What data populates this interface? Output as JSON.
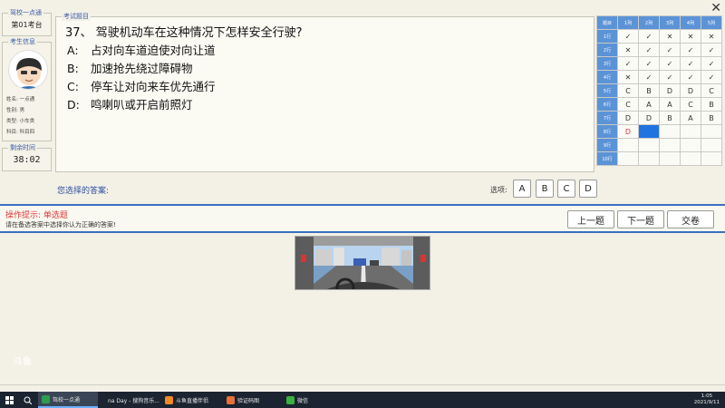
{
  "window": {
    "close_label": "✕"
  },
  "school": {
    "title": "驾校一点通",
    "seat": "第01考台"
  },
  "candidate": {
    "title": "考生信息",
    "rows": [
      {
        "label": "姓名:",
        "value": "一点通"
      },
      {
        "label": "性别:",
        "value": "男"
      },
      {
        "label": "类型:",
        "value": "小车类"
      },
      {
        "label": "科目:",
        "value": "科目四"
      }
    ]
  },
  "timer": {
    "title": "剩余时间",
    "value": "38:02"
  },
  "question": {
    "panel_title": "考试题目",
    "text": "37、 驾驶机动车在这种情况下怎样安全行驶?",
    "options": [
      {
        "letter": "A:",
        "text": "占对向车道迫使对向让道"
      },
      {
        "letter": "B:",
        "text": "加速抢先绕过障碍物"
      },
      {
        "letter": "C:",
        "text": "停车让对向来车优先通行"
      },
      {
        "letter": "D:",
        "text": "鸣喇叭或开启前照灯"
      }
    ]
  },
  "answer": {
    "your_answer_label": "您选择的答案:",
    "options_label": "选项:",
    "buttons": [
      "A",
      "B",
      "C",
      "D"
    ]
  },
  "grid": {
    "corner": "题目",
    "columns": [
      "1列",
      "2列",
      "3列",
      "4列",
      "5列"
    ],
    "rows": [
      {
        "label": "1行",
        "cells": [
          "✓",
          "✓",
          "✕",
          "✕",
          "✕"
        ]
      },
      {
        "label": "2行",
        "cells": [
          "✕",
          "✓",
          "✓",
          "✓",
          "✓"
        ]
      },
      {
        "label": "3行",
        "cells": [
          "✓",
          "✓",
          "✓",
          "✓",
          "✓"
        ]
      },
      {
        "label": "4行",
        "cells": [
          "✕",
          "✓",
          "✓",
          "✓",
          "✓"
        ]
      },
      {
        "label": "5行",
        "cells": [
          "C",
          "B",
          "D",
          "D",
          "C"
        ]
      },
      {
        "label": "6行",
        "cells": [
          "C",
          "A",
          "A",
          "C",
          "B"
        ]
      },
      {
        "label": "7行",
        "cells": [
          "D",
          "D",
          "B",
          "A",
          "B"
        ]
      },
      {
        "label": "8行",
        "cells": [
          "D",
          "",
          "",
          "",
          ""
        ]
      },
      {
        "label": "9行",
        "cells": [
          "",
          "",
          "",
          "",
          ""
        ]
      },
      {
        "label": "10行",
        "cells": [
          "",
          "",
          "",
          "",
          ""
        ]
      }
    ],
    "current_cell_color": "#1f74e0"
  },
  "hint": {
    "title": "操作提示:  单选题",
    "desc": "请在备选答案中选择你认为正确的答案!"
  },
  "nav": {
    "prev": "上一题",
    "next": "下一题",
    "submit": "交卷"
  },
  "watermark": "斗鱼",
  "taskbar": {
    "items": [
      {
        "label": "驾校一点通",
        "icon": "app-icon",
        "color": "#2e9c4f"
      },
      {
        "label": "na Day - 搜狗音乐...",
        "icon": "music-icon",
        "color": "#2a7be4"
      },
      {
        "label": "斗鱼直播伴侣",
        "icon": "douyu-icon",
        "color": "#f08a24"
      },
      {
        "label": "验证码图",
        "icon": "image-icon",
        "color": "#e8703a"
      },
      {
        "label": "微信",
        "icon": "wechat-icon",
        "color": "#3cb043"
      }
    ],
    "time": "1:05",
    "date": "2021/9/11"
  },
  "colors": {
    "accent": "#3b6fc0",
    "header_blue": "#5b93d6",
    "warning_red": "#e03a3a"
  }
}
